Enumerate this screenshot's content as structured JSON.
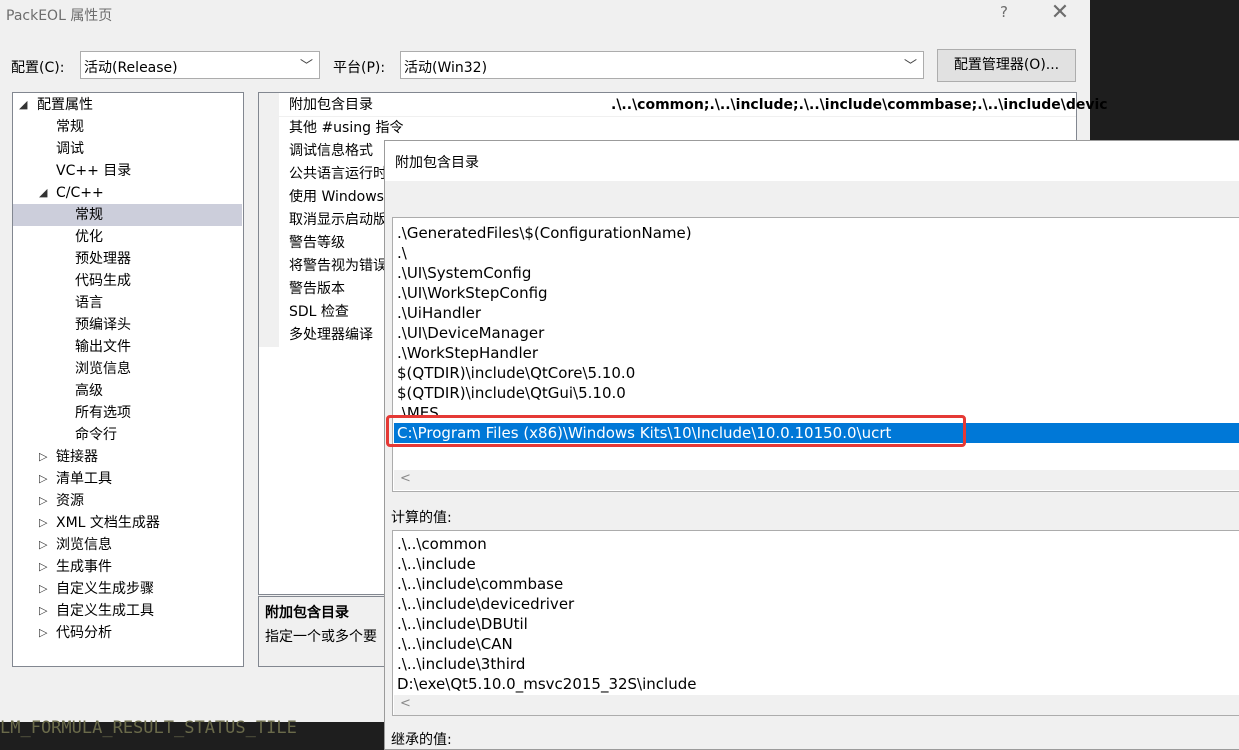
{
  "window": {
    "title": "PackEOL 属性页",
    "help_glyph": "?",
    "close_glyph": "✕"
  },
  "toolbar": {
    "config_label": "配置(C):",
    "config_value": "活动(Release)",
    "platform_label": "平台(P):",
    "platform_value": "活动(Win32)",
    "config_manager_label": "配置管理器(O)..."
  },
  "tree": {
    "items": [
      {
        "label": "配置属性",
        "arrow": "◢"
      },
      {
        "label": "常规"
      },
      {
        "label": "调试"
      },
      {
        "label": "VC++ 目录"
      },
      {
        "label": "C/C++",
        "arrow": "◢"
      },
      {
        "label": "常规",
        "selected": true
      },
      {
        "label": "优化"
      },
      {
        "label": "预处理器"
      },
      {
        "label": "代码生成"
      },
      {
        "label": "语言"
      },
      {
        "label": "预编译头"
      },
      {
        "label": "输出文件"
      },
      {
        "label": "浏览信息"
      },
      {
        "label": "高级"
      },
      {
        "label": "所有选项"
      },
      {
        "label": "命令行"
      },
      {
        "label": "链接器",
        "arrow": "▷"
      },
      {
        "label": "清单工具",
        "arrow": "▷"
      },
      {
        "label": "资源",
        "arrow": "▷"
      },
      {
        "label": "XML 文档生成器",
        "arrow": "▷"
      },
      {
        "label": "浏览信息",
        "arrow": "▷"
      },
      {
        "label": "生成事件",
        "arrow": "▷"
      },
      {
        "label": "自定义生成步骤",
        "arrow": "▷"
      },
      {
        "label": "自定义生成工具",
        "arrow": "▷"
      },
      {
        "label": "代码分析",
        "arrow": "▷"
      }
    ]
  },
  "grid": {
    "rows": [
      {
        "name": "附加包含目录",
        "value": ".\\..\\common;.\\..\\include;.\\..\\include\\commbase;.\\..\\include\\devic"
      },
      {
        "name": "其他 #using 指令"
      },
      {
        "name": "调试信息格式"
      },
      {
        "name": "公共语言运行时"
      },
      {
        "name": "使用 Windows"
      },
      {
        "name": "取消显示启动版"
      },
      {
        "name": "警告等级"
      },
      {
        "name": "将警告视为错误"
      },
      {
        "name": "警告版本"
      },
      {
        "name": "SDL 检查"
      },
      {
        "name": "多处理器编译"
      }
    ],
    "desc_title": "附加包含目录",
    "desc_text": "指定一个或多个要"
  },
  "dialog": {
    "title": "附加包含目录",
    "entries": [
      ".\\GeneratedFiles\\$(ConfigurationName)",
      ".\\",
      ".\\UI\\SystemConfig",
      ".\\UI\\WorkStepConfig",
      ".\\UiHandler",
      ".\\UI\\DeviceManager",
      ".\\WorkStepHandler",
      "$(QTDIR)\\include\\QtCore\\5.10.0",
      "$(QTDIR)\\include\\QtGui\\5.10.0",
      ".\\MES",
      "C:\\Program Files (x86)\\Windows Kits\\10\\Include\\10.0.10150.0\\ucrt"
    ],
    "selected_index": 10,
    "computed_label": "计算的值:",
    "computed_entries": [
      ".\\..\\common",
      ".\\..\\include",
      ".\\..\\include\\commbase",
      ".\\..\\include\\devicedriver",
      ".\\..\\include\\DBUtil",
      ".\\..\\include\\CAN",
      ".\\..\\include\\3third",
      "D:\\exe\\Qt5.10.0_msvc2015_32S\\include"
    ],
    "inherited_label": "继承的值:",
    "scroll_left_glyph": "<"
  },
  "background_code": "LM_FORMULA_RESULT_STATUS_TILE",
  "colors": {
    "selection": "#0078d7",
    "highlight_box": "#e53935",
    "tree_selection": "#cccedb"
  }
}
